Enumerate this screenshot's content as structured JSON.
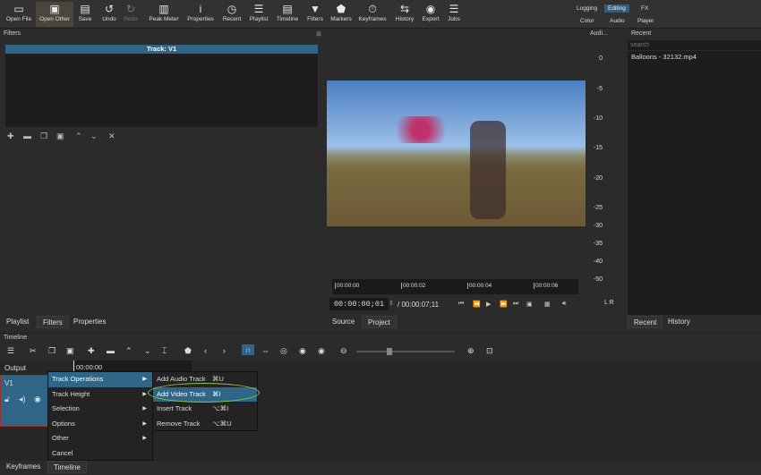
{
  "toolbar": {
    "items": [
      {
        "label": "Open File",
        "icon": "folder-icon",
        "glyph": "▭"
      },
      {
        "label": "Open Other",
        "icon": "open-other-icon",
        "glyph": "▣"
      },
      {
        "label": "Save",
        "icon": "save-icon",
        "glyph": "▤"
      },
      {
        "label": "Undo",
        "icon": "undo-icon",
        "glyph": "↺"
      },
      {
        "label": "Redo",
        "icon": "redo-icon",
        "glyph": "↻"
      },
      {
        "label": "Peak Meter",
        "icon": "peak-meter-icon",
        "glyph": "▥"
      },
      {
        "label": "Properties",
        "icon": "info-icon",
        "glyph": "i"
      },
      {
        "label": "Recent",
        "icon": "clock-icon",
        "glyph": "◷"
      },
      {
        "label": "Playlist",
        "icon": "list-icon",
        "glyph": "☰"
      },
      {
        "label": "Timeline",
        "icon": "timeline-icon",
        "glyph": "▤"
      },
      {
        "label": "Filters",
        "icon": "funnel-icon",
        "glyph": "▼"
      },
      {
        "label": "Markers",
        "icon": "marker-icon",
        "glyph": "⬟"
      },
      {
        "label": "Keyframes",
        "icon": "stopwatch-icon",
        "glyph": "⏱"
      },
      {
        "label": "History",
        "icon": "history-icon",
        "glyph": "⇆"
      },
      {
        "label": "Export",
        "icon": "export-icon",
        "glyph": "◉"
      },
      {
        "label": "Jobs",
        "icon": "jobs-icon",
        "glyph": "☰"
      }
    ],
    "workspaces": [
      "Logging",
      "Editing",
      "FX",
      "Color",
      "Audio",
      "Player"
    ],
    "active_workspace": "Editing"
  },
  "filters": {
    "title": "Filters",
    "track": "Track: V1"
  },
  "left_tabs": [
    "Playlist",
    "Filters",
    "Properties"
  ],
  "audio": {
    "title": "Audi...",
    "scale": [
      "0",
      "-5",
      "-10",
      "-15",
      "-20",
      "-25",
      "-30",
      "-35",
      "-40",
      "-50"
    ],
    "channels": "L R"
  },
  "viewer": {
    "ruler": [
      "00:00:00",
      "00:00:02",
      "00:00:04",
      "00:00:06"
    ],
    "timecode": "00:00:00;01",
    "duration": "/ 00:00:07;11",
    "tabs": [
      "Source",
      "Project"
    ]
  },
  "recent": {
    "title": "Recent",
    "search_placeholder": "search",
    "items": [
      "Balloons - 32132.mp4"
    ],
    "tabs": [
      "Recent",
      "History"
    ]
  },
  "timeline": {
    "title": "Timeline",
    "output": "Output",
    "ruler_time": "00:00:00",
    "track": "V1",
    "bottom_tabs": [
      "Keyframes",
      "Timeline"
    ]
  },
  "context_menu": {
    "items": [
      "Track Operations",
      "Track Height",
      "Selection",
      "Options",
      "Other",
      "Cancel"
    ],
    "submenu": [
      {
        "label": "Add Audio Track",
        "shortcut": "⌘U"
      },
      {
        "label": "Add Video Track",
        "shortcut": "⌘I"
      },
      {
        "label": "Insert Track",
        "shortcut": "⌥⌘I"
      },
      {
        "label": "Remove Track",
        "shortcut": "⌥⌘U"
      }
    ]
  },
  "colors": {
    "accent": "#2f6687",
    "highlight_ring": "#8fc84a"
  }
}
